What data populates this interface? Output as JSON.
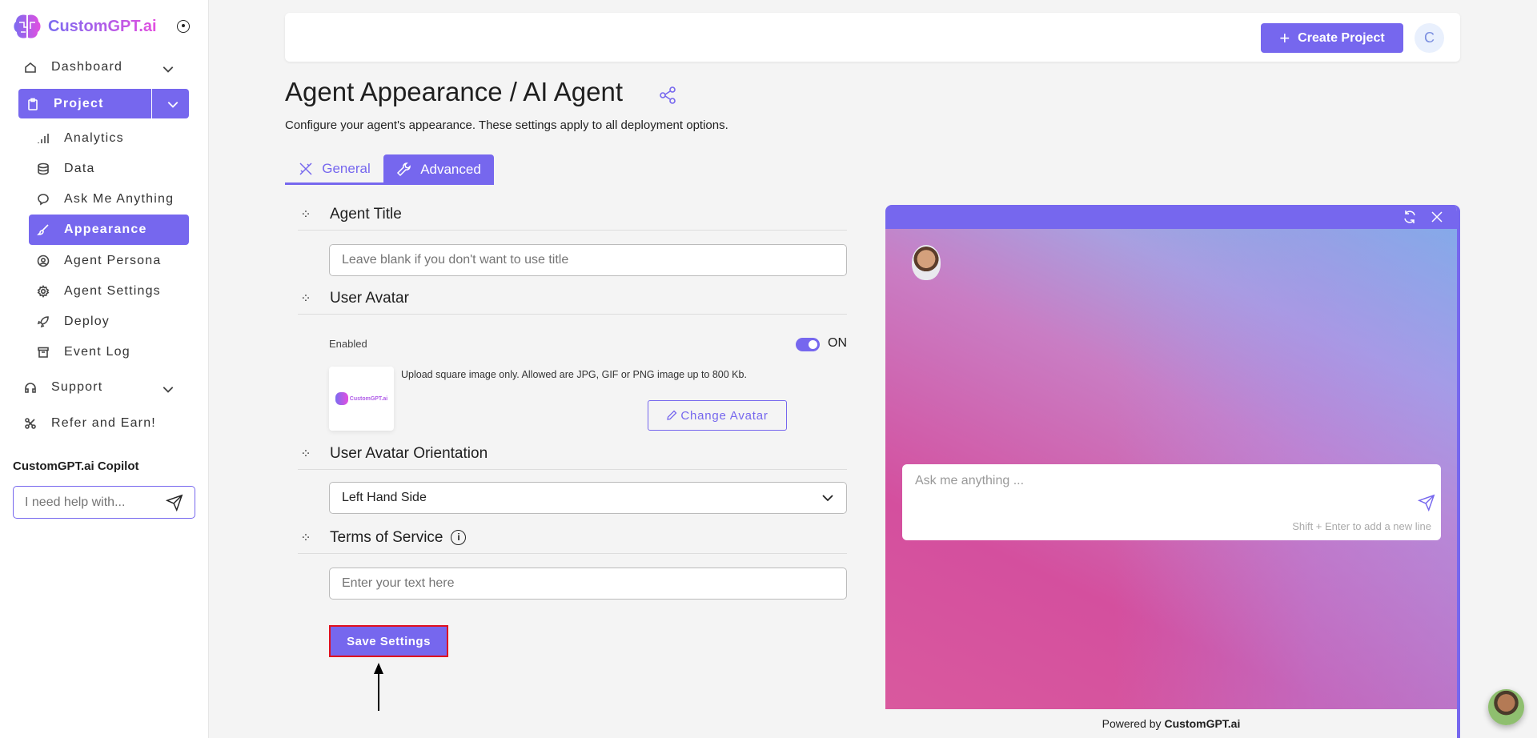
{
  "brand": {
    "name": "CustomGPT.ai"
  },
  "sidebar": {
    "items": [
      {
        "label": "Dashboard",
        "icon": "home-icon"
      },
      {
        "label": "Project",
        "icon": "clipboard-icon"
      },
      {
        "label": "Analytics",
        "icon": "bar-chart-icon"
      },
      {
        "label": "Data",
        "icon": "database-icon"
      },
      {
        "label": "Ask Me Anything",
        "icon": "chat-icon"
      },
      {
        "label": "Appearance",
        "icon": "brush-icon"
      },
      {
        "label": "Agent Persona",
        "icon": "user-circle-icon"
      },
      {
        "label": "Agent Settings",
        "icon": "gear-icon"
      },
      {
        "label": "Deploy",
        "icon": "rocket-icon"
      },
      {
        "label": "Event Log",
        "icon": "archive-icon"
      },
      {
        "label": "Support",
        "icon": "headphones-icon"
      },
      {
        "label": "Refer and Earn!",
        "icon": "share-nodes-icon"
      }
    ],
    "copilot": {
      "label": "CustomGPT.ai Copilot",
      "placeholder": "I need help with..."
    }
  },
  "header": {
    "create_project": "Create Project",
    "avatar_initial": "C"
  },
  "page": {
    "title": "Agent Appearance / AI Agent",
    "subtitle": "Configure your agent's appearance. These settings apply to all deployment options.",
    "tabs": [
      {
        "label": "General",
        "active": false
      },
      {
        "label": "Advanced",
        "active": true
      }
    ]
  },
  "form": {
    "agent_title": {
      "label": "Agent Title",
      "placeholder": "Leave blank if you don't want to use title"
    },
    "user_avatar": {
      "label": "User Avatar",
      "enabled_label": "Enabled",
      "toggle": true,
      "toggle_label": "ON",
      "hint": "Upload square image only. Allowed are JPG, GIF or PNG image up to 800 Kb.",
      "change_button": "Change Avatar",
      "avatar_logo_text": "CustomGPT.ai"
    },
    "orientation": {
      "label": "User Avatar Orientation",
      "value": "Left Hand Side"
    },
    "terms": {
      "label": "Terms of Service",
      "placeholder": "Enter your text here"
    },
    "save_button": "Save Settings"
  },
  "preview": {
    "input_placeholder": "Ask me anything ...",
    "hint": "Shift + Enter to add a new line",
    "powered_by": "Powered by",
    "powered_brand": "CustomGPT.ai"
  },
  "colors": {
    "accent": "#7667ee",
    "highlight": "#e0101e"
  }
}
